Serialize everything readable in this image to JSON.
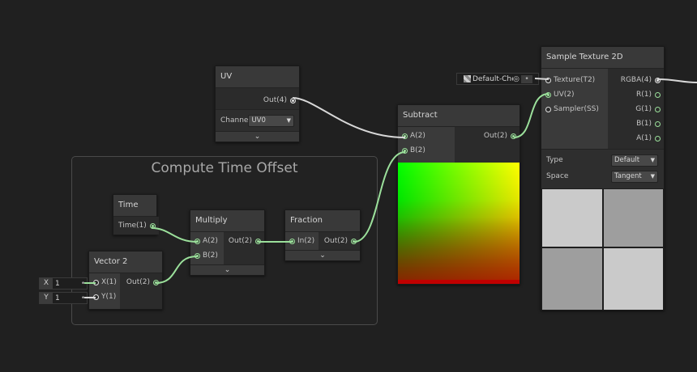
{
  "group": {
    "title": "Compute Time Offset"
  },
  "uv_node": {
    "title": "UV",
    "output": "Out(4)",
    "channel_label": "Channe",
    "channel_value": "UV0"
  },
  "time_node": {
    "title": "Time",
    "output": "Time(1)"
  },
  "multiply_node": {
    "title": "Multiply",
    "inputs": [
      "A(2)",
      "B(2)"
    ],
    "output": "Out(2)"
  },
  "fraction_node": {
    "title": "Fraction",
    "input": "In(2)",
    "output": "Out(2)"
  },
  "vector2_node": {
    "title": "Vector 2",
    "inputs": [
      "X(1)",
      "Y(1)"
    ],
    "output": "Out(2)",
    "fields": [
      {
        "label": "X",
        "value": "1"
      },
      {
        "label": "Y",
        "value": "1"
      }
    ]
  },
  "subtract_node": {
    "title": "Subtract",
    "inputs": [
      "A(2)",
      "B(2)"
    ],
    "output": "Out(2)"
  },
  "sample_node": {
    "title": "Sample Texture 2D",
    "inputs": [
      "Texture(T2)",
      "UV(2)",
      "Sampler(SS)"
    ],
    "outputs": [
      "RGBA(4)",
      "R(1)",
      "G(1)",
      "B(1)",
      "A(1)"
    ],
    "type_label": "Type",
    "type_value": "Default",
    "space_label": "Space",
    "space_value": "Tangent"
  },
  "texture_field": {
    "value": "Default-Che"
  },
  "colors": {
    "wire_green": "#9be09b",
    "wire_white": "#d8d8d8"
  }
}
